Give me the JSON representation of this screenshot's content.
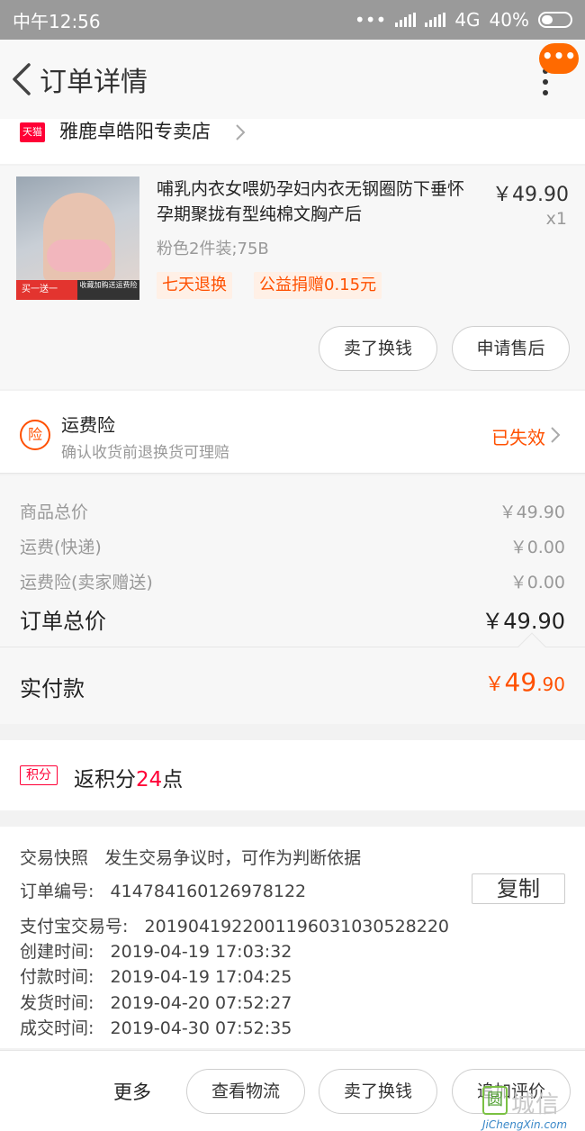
{
  "status_bar": {
    "time": "中午12:56",
    "network": "4G",
    "battery": "40%"
  },
  "header": {
    "title": "订单详情",
    "float_dots": "•••"
  },
  "shop": {
    "badge": "天猫",
    "name": "雅鹿卓皓阳专卖店"
  },
  "product": {
    "title": "哺乳内衣女喂奶孕妇内衣无钢圈防下垂怀孕期聚拢有型纯棉文胸产后",
    "price": "￥49.90",
    "quantity": "x1",
    "sku": "粉色2件装;75B",
    "tags": [
      "七天退换",
      "公益捐赠0.15元"
    ],
    "image_labels": {
      "promo": "买一送一",
      "promo_note": "收藏加购送运费险"
    },
    "buttons": {
      "resell": "卖了换钱",
      "after_sale": "申请售后"
    }
  },
  "insurance": {
    "icon_text": "险",
    "title": "运费险",
    "subtitle": "确认收货前退换货可理赔",
    "status": "已失效"
  },
  "summary": {
    "goods_label": "商品总价",
    "goods_value": "￥49.90",
    "shipping_label": "运费(快递)",
    "shipping_value": "￥0.00",
    "insurance_label": "运费险(卖家赠送)",
    "insurance_value": "￥0.00",
    "total_label": "订单总价",
    "total_value": "￥49.90"
  },
  "paid": {
    "label": "实付款",
    "currency": "￥",
    "integer": "49",
    "decimal": ".90"
  },
  "points": {
    "badge": "积分",
    "prefix": "返积分",
    "number": "24",
    "suffix": "点"
  },
  "order_info": {
    "snapshot_label": "交易快照",
    "snapshot_desc": "发生交易争议时，可作为判断依据",
    "order_no_label": "订单编号:",
    "order_no": "414784160126978122",
    "copy_label": "复制",
    "alipay_label": "支付宝交易号:",
    "alipay_no": "2019041922001196031030528220",
    "created_label": "创建时间:",
    "created": "2019-04-19 17:03:32",
    "paid_label": "付款时间:",
    "paid": "2019-04-19 17:04:25",
    "shipped_label": "发货时间:",
    "shipped": "2019-04-20 07:52:27",
    "completed_label": "成交时间:",
    "completed": "2019-04-30 07:52:35"
  },
  "bottom_bar": {
    "more": "更多",
    "logistics": "查看物流",
    "resell": "卖了换钱",
    "review": "追加评价"
  },
  "watermark": {
    "icon": "圆",
    "text": "城信",
    "url": "JiChengXin.com"
  },
  "colors": {
    "accent": "#ff5000",
    "tmall": "#ff0036",
    "status_bar": "#9a9a9a"
  }
}
